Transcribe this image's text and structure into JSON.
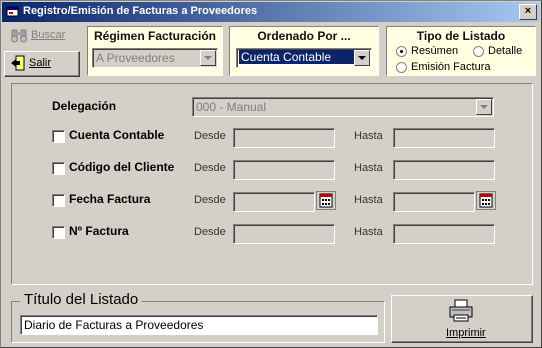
{
  "window": {
    "title": "Registro/Emisión de Facturas a Proveedores",
    "close_glyph": "×"
  },
  "toolbar": {
    "buscar_label": "Buscar",
    "salir_label": "Salir"
  },
  "regimen": {
    "title": "Régimen Facturación",
    "value": "A Proveedores"
  },
  "ordenado": {
    "title": "Ordenado Por ...",
    "value": "Cuenta Contable"
  },
  "tipo": {
    "title": "Tipo de Listado",
    "opt_resumen": "Resúmen",
    "opt_detalle": "Detalle",
    "opt_emision": "Emisión Factura",
    "selected": "Resúmen"
  },
  "filters": {
    "delegacion_label": "Delegación",
    "delegacion_value": "000 - Manual",
    "desde": "Desde",
    "hasta": "Hasta",
    "rows": [
      {
        "label": "Cuenta Contable",
        "checked": false
      },
      {
        "label": "Código del Cliente",
        "checked": false
      },
      {
        "label": "Fecha Factura",
        "checked": false
      },
      {
        "label": "Nº Factura",
        "checked": false
      }
    ]
  },
  "titulo": {
    "legend": "Título del Listado",
    "value": "Diario de Facturas a Proveedores"
  },
  "imprimir": {
    "label": "Imprimir"
  }
}
